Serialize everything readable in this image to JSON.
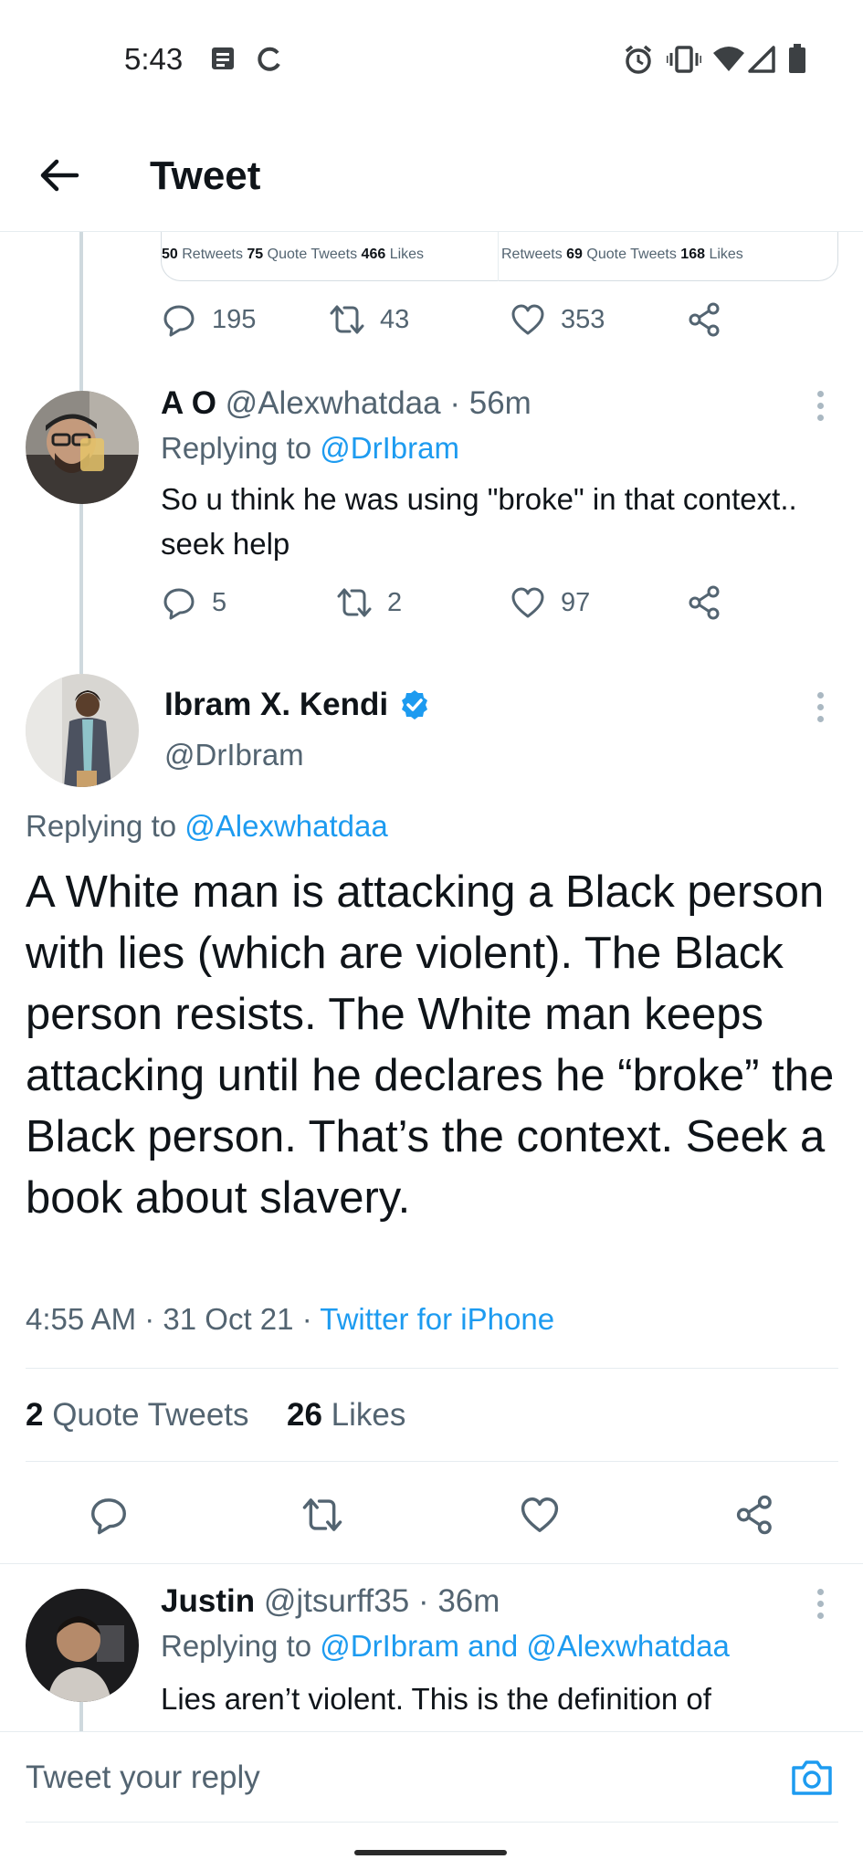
{
  "status_bar": {
    "time": "5:43",
    "left_icons": [
      "notes-icon",
      "sync-icon"
    ],
    "right_icons": [
      "alarm-icon",
      "vibrate-icon",
      "wifi-icon",
      "signal-icon",
      "battery-icon"
    ]
  },
  "header": {
    "title": "Tweet"
  },
  "quote_card": {
    "left": {
      "retweets": "50",
      "retweets_label": "Retweets",
      "quotes": "75",
      "quotes_label": "Quote Tweets",
      "likes": "466",
      "likes_label": "Likes"
    },
    "right": {
      "retweets_label": "Retweets",
      "quotes": "69",
      "quotes_label": "Quote Tweets",
      "likes": "168",
      "likes_label": "Likes"
    }
  },
  "parent_actions": {
    "replies": "195",
    "retweets": "43",
    "likes": "353"
  },
  "reply_ao": {
    "name": "A O",
    "handle": "@Alexwhatdaa",
    "time": "· 56m",
    "replying_prefix": "Replying to",
    "replying_to": "@DrIbram",
    "text": "So u think he was using \"broke\" in that context.. seek help",
    "replies": "5",
    "retweets": "2",
    "likes": "97"
  },
  "main_tweet": {
    "name": "Ibram X. Kendi",
    "handle": "@DrIbram",
    "verified_color": "#1d9bf0",
    "replying_prefix": "Replying to",
    "replying_to": "@Alexwhatdaa",
    "text": "A White man is attacking a Black person with lies (which are violent). The Black person resists. The White man keeps attacking until he declares he “broke” the Black person. That’s the context. Seek a book about slavery.",
    "time": "4:55 AM",
    "date": "31 Oct 21",
    "source": "Twitter for iPhone",
    "sep": "·",
    "quote_count": "2",
    "quote_label": "Quote Tweets",
    "like_count": "26",
    "like_label": "Likes"
  },
  "reply_justin": {
    "name": "Justin",
    "handle": "@jtsurff35",
    "time": "· 36m",
    "replying_prefix": "Replying to",
    "replying_to": "@DrIbram and @Alexwhatdaa",
    "text": "Lies aren’t violent. This is the definition of"
  },
  "reply_bar": {
    "placeholder": "Tweet your reply"
  },
  "colors": {
    "accent": "#1d9bf0",
    "text": "#0f1419",
    "secondary": "#536471"
  }
}
